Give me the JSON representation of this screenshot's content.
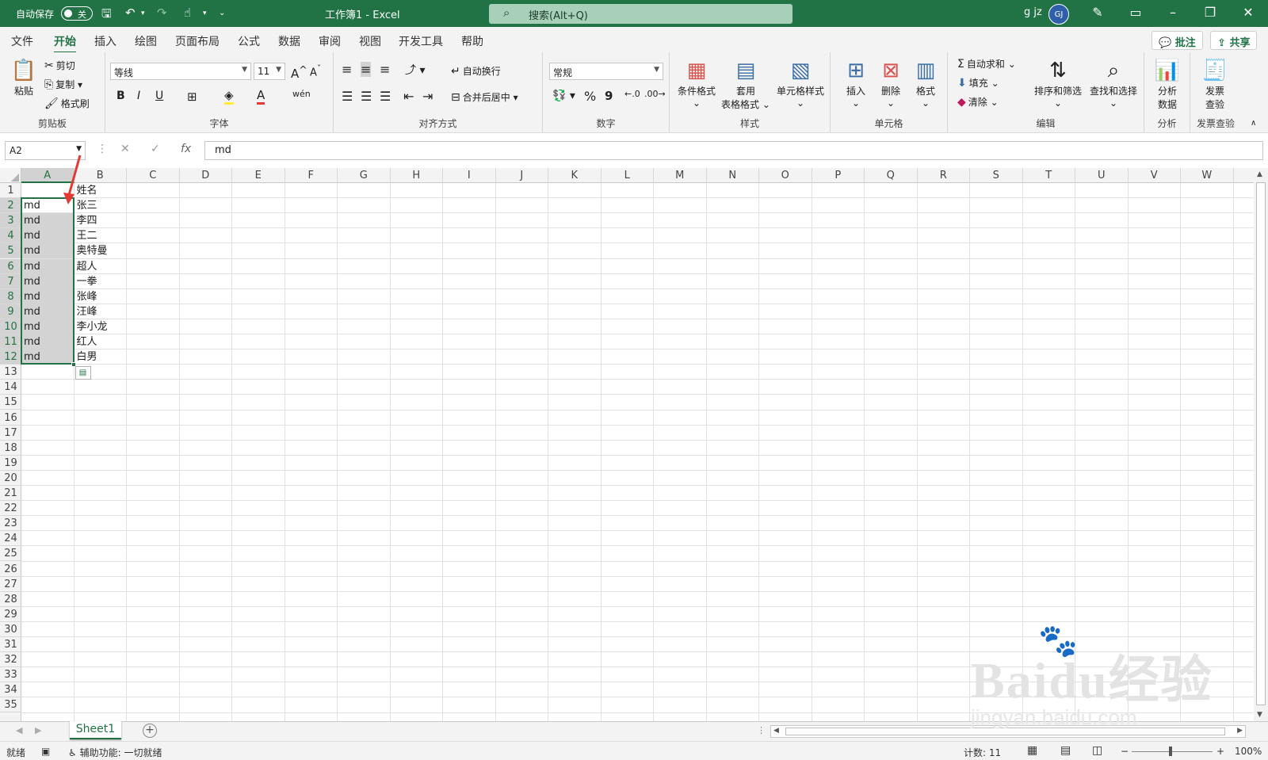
{
  "titlebar": {
    "autosave_label": "自动保存",
    "autosave_state": "关",
    "doc_title": "工作簿1  -  Excel",
    "search_placeholder": "搜索(Alt+Q)",
    "user_name": "g jz",
    "user_initials": "GJ"
  },
  "menu": {
    "tabs": [
      "文件",
      "开始",
      "插入",
      "绘图",
      "页面布局",
      "公式",
      "数据",
      "审阅",
      "视图",
      "开发工具",
      "帮助"
    ],
    "active_tab": "开始",
    "comment_label": "批注",
    "share_label": "共享"
  },
  "ribbon": {
    "clipboard": {
      "paste": "粘贴",
      "cut": "剪切",
      "copy": "复制",
      "format_painter": "格式刷",
      "label": "剪贴板"
    },
    "font": {
      "font_name": "等线",
      "font_size": "11",
      "bold": "B",
      "italic": "I",
      "underline": "U",
      "label": "字体"
    },
    "alignment": {
      "wrap_text": "自动换行",
      "merge_center": "合并后居中",
      "label": "对齐方式"
    },
    "number": {
      "format": "常规",
      "percent": "%",
      "comma": "9",
      "label": "数字"
    },
    "styles": {
      "conditional": "条件格式",
      "table_line1": "套用",
      "table_line2": "表格格式",
      "cell_styles": "单元格样式",
      "label": "样式"
    },
    "cells": {
      "insert": "插入",
      "delete": "删除",
      "format": "格式",
      "label": "单元格"
    },
    "editing": {
      "autosum": "自动求和",
      "fill": "填充",
      "clear": "清除",
      "sort_filter": "排序和筛选",
      "find_select": "查找和选择",
      "label": "编辑"
    },
    "analysis": {
      "analyze_line1": "分析",
      "analyze_line2": "数据",
      "label": "分析"
    },
    "invoice": {
      "line1": "发票",
      "line2": "查验",
      "label": "发票查验"
    }
  },
  "formula_bar": {
    "name_box": "A2",
    "fx": "fx",
    "formula": "md"
  },
  "sheet": {
    "columns": [
      "A",
      "B",
      "C",
      "D",
      "E",
      "F",
      "G",
      "H",
      "I",
      "J",
      "K",
      "L",
      "M",
      "N",
      "O",
      "P",
      "Q",
      "R",
      "S",
      "T",
      "U",
      "V",
      "W"
    ],
    "rows": [
      "1",
      "2",
      "3",
      "4",
      "5",
      "6",
      "7",
      "8",
      "9",
      "10",
      "11",
      "12",
      "13",
      "14",
      "15",
      "16",
      "17",
      "18",
      "19",
      "20",
      "21",
      "22",
      "23",
      "24",
      "25",
      "26",
      "27",
      "28",
      "29",
      "30",
      "31",
      "32",
      "33",
      "34",
      "35"
    ],
    "col_a": [
      "",
      "md",
      "md",
      "md",
      "md",
      "md",
      "md",
      "md",
      "md",
      "md",
      "md",
      "md"
    ],
    "col_b": [
      "姓名",
      "张三",
      "李四",
      "王二",
      "奥特曼",
      "超人",
      "一拳",
      "张峰",
      "汪峰",
      "李小龙",
      "红人",
      "白男"
    ],
    "selection": "A2:A12"
  },
  "sheet_tabs": {
    "active": "Sheet1",
    "add": "+"
  },
  "status": {
    "ready": "就绪",
    "accessibility": "辅助功能: 一切就绪",
    "count": "计数: 11",
    "zoom": "100%"
  },
  "watermark": {
    "brand": "Baidu经验",
    "url": "jingyan.baidu.com"
  },
  "colors": {
    "brand": "#217346",
    "arrow": "#e53935"
  }
}
